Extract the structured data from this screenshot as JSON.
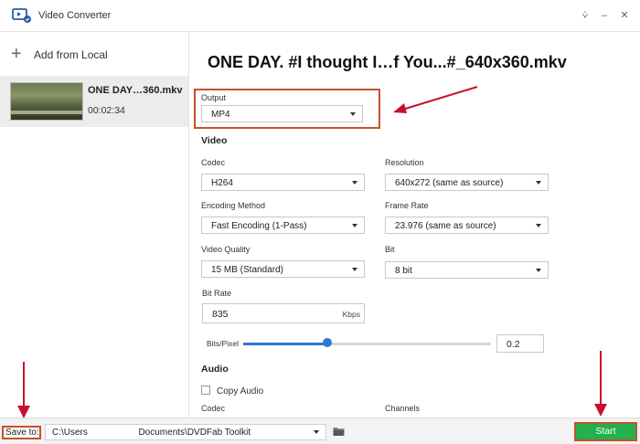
{
  "window": {
    "title": "Video Converter",
    "menu_glyph": "⩒",
    "minimize_glyph": "–",
    "close_glyph": "✕"
  },
  "sidebar": {
    "add_label": "Add from Local",
    "add_icon": "plus-icon",
    "file": {
      "name": "ONE DAY…360.mkv",
      "duration": "00:02:34"
    }
  },
  "main": {
    "title": "ONE DAY. #I thought I…f You...#_640x360.mkv",
    "output": {
      "label": "Output",
      "value": "MP4"
    },
    "video_section": "Video",
    "codec": {
      "label": "Codec",
      "value": "H264"
    },
    "resolution": {
      "label": "Resolution",
      "value": "640x272 (same as source)"
    },
    "encoding_method": {
      "label": "Encoding Method",
      "value": "Fast Encoding (1-Pass)"
    },
    "frame_rate": {
      "label": "Frame Rate",
      "value": "23.976 (same as source)"
    },
    "video_quality": {
      "label": "Video Quality",
      "value": "15 MB (Standard)"
    },
    "bit": {
      "label": "Bit",
      "value": "8 bit"
    },
    "bit_rate": {
      "label": "Bit Rate",
      "value": "835",
      "unit": "Kbps"
    },
    "bits_per_pixel": {
      "label": "Bits/Pixel",
      "value": "0.2",
      "slider_fraction": 0.34
    },
    "audio_section": "Audio",
    "copy_audio": {
      "label": "Copy Audio",
      "checked": false
    },
    "audio_codec_label": "Codec",
    "channels_label": "Channels"
  },
  "bottom": {
    "save_to_label": "Save to:",
    "path": "C:\\Users                    Documents\\DVDFab Toolkit",
    "start_label": "Start"
  },
  "colors": {
    "accent": "#2b78d6",
    "start_green": "#22b14c",
    "highlight_red": "#c8502a",
    "arrow_red": "#c8102e"
  }
}
